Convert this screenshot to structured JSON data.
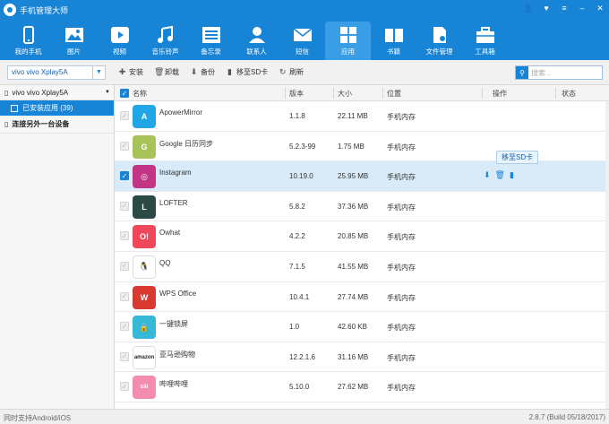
{
  "window": {
    "title": "手机管理大师",
    "controls": [
      "user-icon",
      "heart-icon",
      "menu-icon",
      "minimize-icon",
      "close-icon"
    ]
  },
  "nav": [
    {
      "label": "我的手机",
      "icon": "phone-icon"
    },
    {
      "label": "图片",
      "icon": "image-icon"
    },
    {
      "label": "视频",
      "icon": "video-icon"
    },
    {
      "label": "音乐铃声",
      "icon": "music-icon"
    },
    {
      "label": "备忘录",
      "icon": "memo-icon"
    },
    {
      "label": "联系人",
      "icon": "contacts-icon"
    },
    {
      "label": "短信",
      "icon": "sms-icon"
    },
    {
      "label": "应用",
      "icon": "apps-icon",
      "active": true
    },
    {
      "label": "书籍",
      "icon": "book-icon"
    },
    {
      "label": "文件管理",
      "icon": "file-manager-icon"
    },
    {
      "label": "工具箱",
      "icon": "toolbox-icon"
    }
  ],
  "toolbar": {
    "device": "vivo vivo Xplay5A",
    "install": "安装",
    "uninstall": "卸载",
    "backup": "备份",
    "move_sd": "移至SD卡",
    "refresh": "刷新",
    "search_placeholder": "搜索..."
  },
  "sidebar": {
    "device": "vivo vivo Xplay5A",
    "installed": "已安装应用 (39)",
    "connect": "连接另外一台设备"
  },
  "table": {
    "headers": {
      "name": "名称",
      "version": "版本",
      "size": "大小",
      "location": "位置",
      "ops": "操作",
      "status": "状态"
    },
    "tooltip": "移至SD卡",
    "rows": [
      {
        "name": "ApowerMirror",
        "version": "1.1.8",
        "size": "22.11 MB",
        "location": "手机内存",
        "color": "#23a6e8",
        "mark": "A"
      },
      {
        "name": "Google 日历同步",
        "version": "5.2.3-99",
        "size": "1.75 MB",
        "location": "手机内存",
        "color": "#a7c35a",
        "mark": "G"
      },
      {
        "name": "Instagram",
        "version": "10.19.0",
        "size": "25.95 MB",
        "location": "手机内存",
        "color": "#c13584",
        "mark": "◎",
        "selected": true
      },
      {
        "name": "LOFTER",
        "version": "5.8.2",
        "size": "37.36 MB",
        "location": "手机内存",
        "color": "#2b4a45",
        "mark": "L"
      },
      {
        "name": "Owhat",
        "version": "4.2.2",
        "size": "20.85 MB",
        "location": "手机内存",
        "color": "#f0475a",
        "mark": "O!"
      },
      {
        "name": "QQ",
        "version": "7.1.5",
        "size": "41.55 MB",
        "location": "手机内存",
        "color": "#ffffff",
        "mark": "🐧"
      },
      {
        "name": "WPS Office",
        "version": "10.4.1",
        "size": "27.74 MB",
        "location": "手机内存",
        "color": "#d83a32",
        "mark": "W"
      },
      {
        "name": "一键锁屏",
        "version": "1.0",
        "size": "42.60 KB",
        "location": "手机内存",
        "color": "#36b9d6",
        "mark": "🔒"
      },
      {
        "name": "亚马逊购物",
        "version": "12.2.1.6",
        "size": "31.16 MB",
        "location": "手机内存",
        "color": "#ffffff",
        "mark": "amazon"
      },
      {
        "name": "哔哩哔哩",
        "version": "5.10.0",
        "size": "27.62 MB",
        "location": "手机内存",
        "color": "#f68bb0",
        "mark": "bili"
      }
    ]
  },
  "status": {
    "left": "同时支持Android/iOS",
    "right": "2.8.7 (Build 05/18/2017)"
  }
}
